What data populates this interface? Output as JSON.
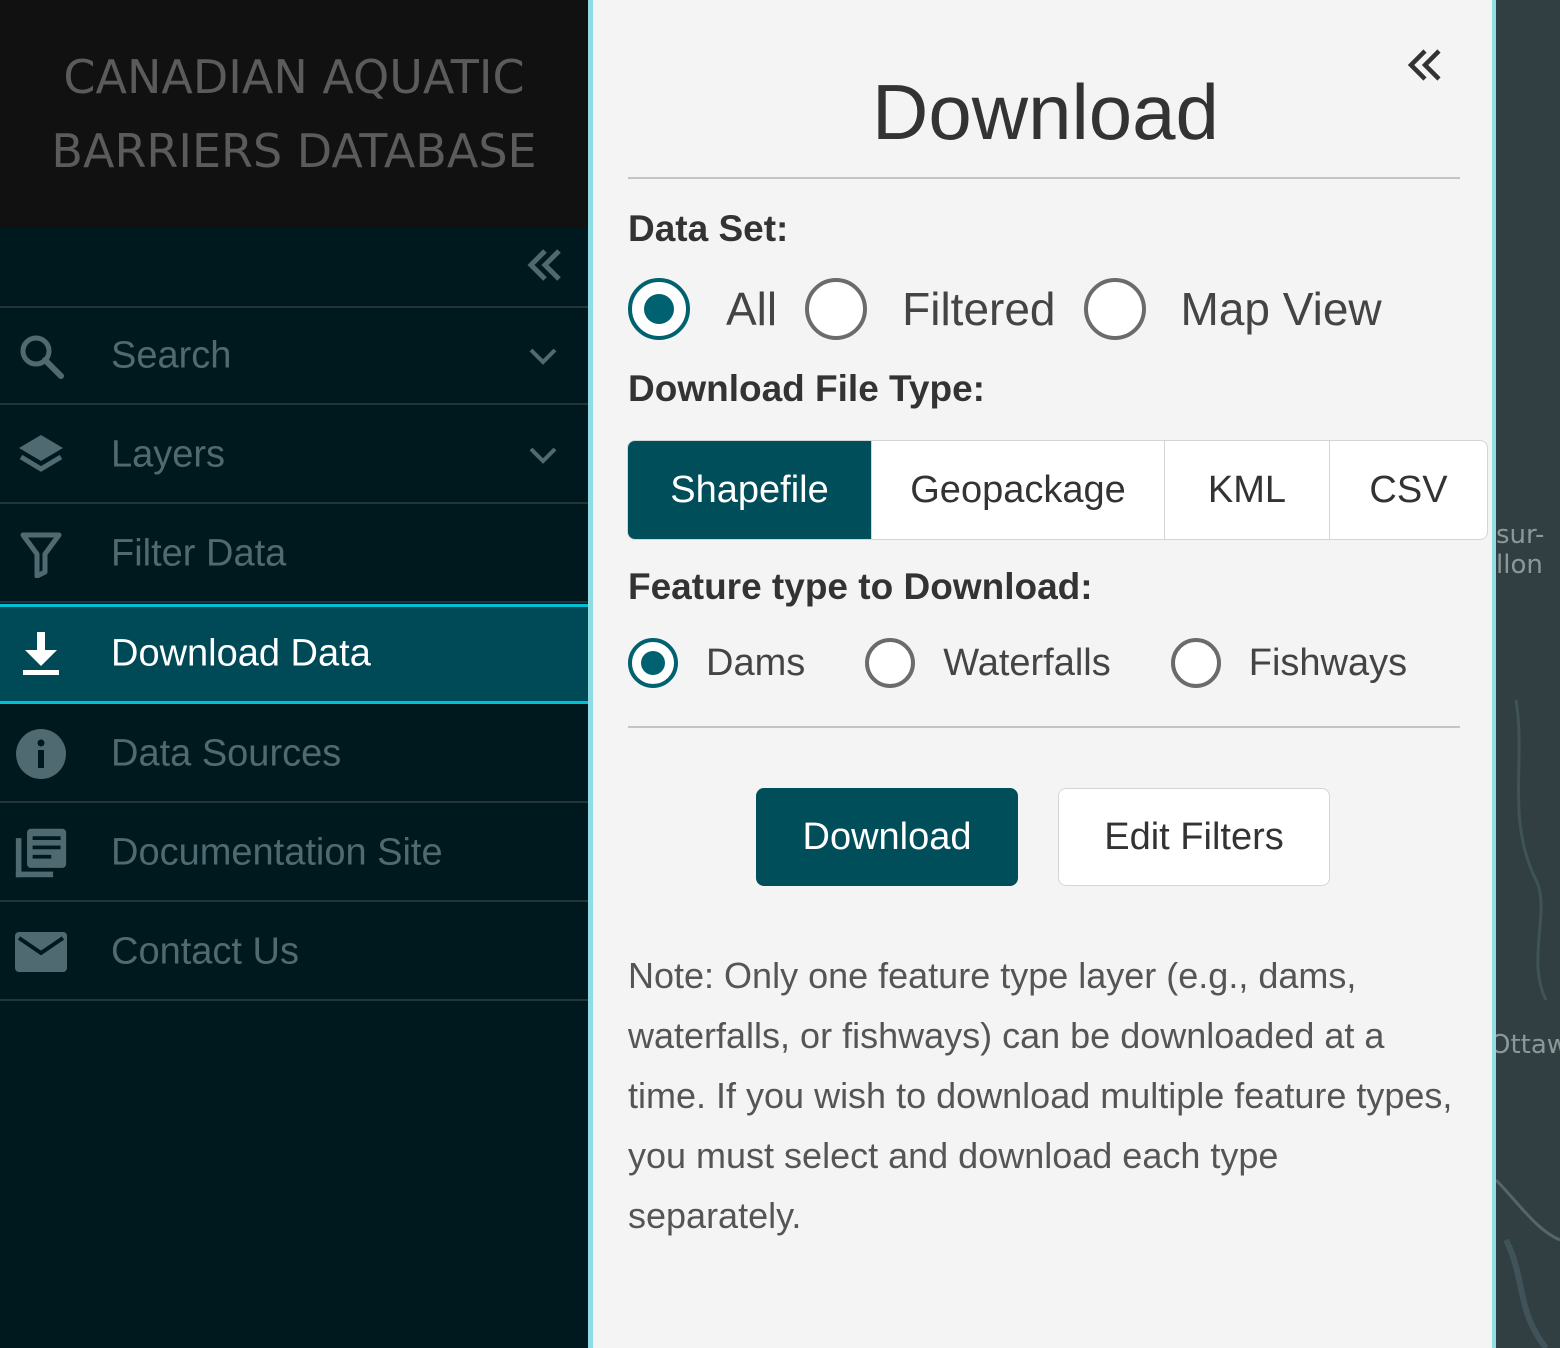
{
  "sidebar": {
    "app_title_line1": "CANADIAN AQUATIC",
    "app_title_line2": "BARRIERS DATABASE",
    "collapse_icon": "double-chevron-left-icon",
    "items": [
      {
        "label": "Search",
        "icon": "search-icon",
        "has_chevron": true
      },
      {
        "label": "Layers",
        "icon": "layers-icon",
        "has_chevron": true
      },
      {
        "label": "Filter Data",
        "icon": "filter-icon",
        "has_chevron": false
      },
      {
        "label": "Download Data",
        "icon": "download-icon",
        "has_chevron": false,
        "active": true
      },
      {
        "label": "Data Sources",
        "icon": "info-icon",
        "has_chevron": false
      },
      {
        "label": "Documentation Site",
        "icon": "documentation-icon",
        "has_chevron": false
      },
      {
        "label": "Contact Us",
        "icon": "mail-icon",
        "has_chevron": false
      }
    ]
  },
  "panel": {
    "title": "Download",
    "collapse_icon": "double-chevron-left-icon",
    "dataset": {
      "label": "Data Set:",
      "options": [
        "All",
        "Filtered",
        "Map View"
      ],
      "selected": "All"
    },
    "file_type": {
      "label": "Download File Type:",
      "options": [
        "Shapefile",
        "Geopackage",
        "KML",
        "CSV"
      ],
      "selected": "Shapefile"
    },
    "feature_type": {
      "label": "Feature type to Download:",
      "options": [
        "Dams",
        "Waterfalls",
        "Fishways"
      ],
      "selected": "Dams"
    },
    "download_button": "Download",
    "edit_filters_button": "Edit Filters",
    "note": "Note: Only one feature type layer (e.g., dams, waterfalls, or fishways) can be downloaded at a time. If you wish to download multiple feature types, you must select and download each type separately."
  },
  "map": {
    "labels": [
      "sur-",
      "llon",
      "Ottaw"
    ]
  },
  "colors": {
    "sidebar_bg": "#00191f",
    "header_bg": "#111111",
    "accent": "#004e5a",
    "active_border": "#00c2d4",
    "panel_bg": "#f4f4f4"
  }
}
